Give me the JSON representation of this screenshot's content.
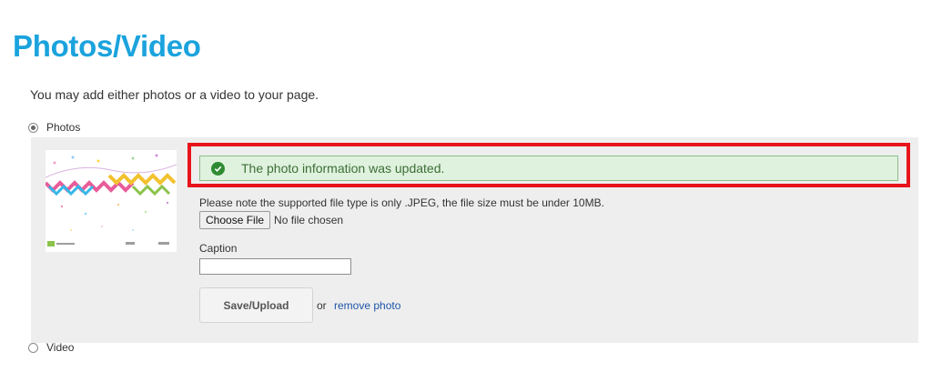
{
  "page": {
    "title": "Photos/Video",
    "intro": "You may add either photos or a video to your page."
  },
  "media_choice": {
    "photos_label": "Photos",
    "video_label": "Video",
    "selected": "Photos"
  },
  "photo_panel": {
    "alert_message": "The photo information was updated.",
    "alert_icon": "check-circle-icon",
    "file_note": "Please note the supported file type is only .JPEG, the file size must be under 10MB.",
    "choose_file_label": "Choose File",
    "file_status": "No file chosen",
    "caption_label": "Caption",
    "caption_value": "",
    "save_label": "Save/Upload",
    "or_text": "or",
    "remove_label": "remove photo"
  },
  "colors": {
    "title": "#1ba3dd",
    "highlight_border": "#e8141b",
    "alert_background": "#dff2de",
    "alert_text": "#3c6e35",
    "link": "#1f55a8",
    "panel_background": "#eeeeee"
  }
}
